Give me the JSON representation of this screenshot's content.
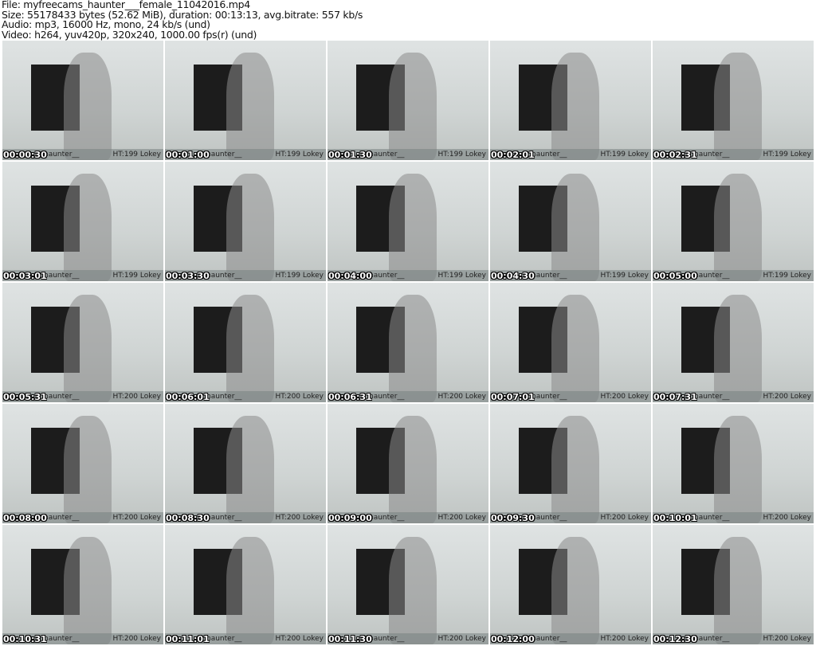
{
  "header": {
    "file": "File: myfreecams_haunter___female_11042016.mp4",
    "size": "Size: 55178433 bytes (52.62 MiB), duration: 00:13:13, avg.bitrate: 557 kb/s",
    "audio": "Audio: mp3, 16000 Hz, mono, 24 kb/s (und)",
    "video": "Video: h264, yuv420p, 320x240, 1000.00 fps(r) (und)"
  },
  "thumbnails": [
    {
      "time": "00:00:30",
      "user": "haunter__",
      "ht": "HT:199 Lokey"
    },
    {
      "time": "00:01:00",
      "user": "haunter__",
      "ht": "HT:199 Lokey"
    },
    {
      "time": "00:01:30",
      "user": "haunter__",
      "ht": "HT:199 Lokey"
    },
    {
      "time": "00:02:01",
      "user": "haunter__",
      "ht": "HT:199 Lokey"
    },
    {
      "time": "00:02:31",
      "user": "haunter__",
      "ht": "HT:199 Lokey"
    },
    {
      "time": "00:03:01",
      "user": "haunter__",
      "ht": "HT:199 Lokey"
    },
    {
      "time": "00:03:30",
      "user": "haunter__",
      "ht": "HT:199 Lokey"
    },
    {
      "time": "00:04:00",
      "user": "haunter__",
      "ht": "HT:199 Lokey"
    },
    {
      "time": "00:04:30",
      "user": "haunter__",
      "ht": "HT:199 Lokey"
    },
    {
      "time": "00:05:00",
      "user": "haunter__",
      "ht": "HT:199 Lokey"
    },
    {
      "time": "00:05:31",
      "user": "haunter__",
      "ht": "HT:200 Lokey"
    },
    {
      "time": "00:06:01",
      "user": "haunter__",
      "ht": "HT:200 Lokey"
    },
    {
      "time": "00:06:31",
      "user": "haunter__",
      "ht": "HT:200 Lokey"
    },
    {
      "time": "00:07:01",
      "user": "haunter__",
      "ht": "HT:200 Lokey"
    },
    {
      "time": "00:07:31",
      "user": "haunter__",
      "ht": "HT:200 Lokey"
    },
    {
      "time": "00:08:00",
      "user": "haunter__",
      "ht": "HT:200 Lokey"
    },
    {
      "time": "00:08:30",
      "user": "haunter__",
      "ht": "HT:200 Lokey"
    },
    {
      "time": "00:09:00",
      "user": "haunter__",
      "ht": "HT:200 Lokey"
    },
    {
      "time": "00:09:30",
      "user": "haunter__",
      "ht": "HT:200 Lokey"
    },
    {
      "time": "00:10:01",
      "user": "haunter__",
      "ht": "HT:200 Lokey"
    },
    {
      "time": "00:10:31",
      "user": "haunter__",
      "ht": "HT:200 Lokey"
    },
    {
      "time": "00:11:01",
      "user": "haunter__",
      "ht": "HT:200 Lokey"
    },
    {
      "time": "00:11:30",
      "user": "haunter__",
      "ht": "HT:200 Lokey"
    },
    {
      "time": "00:12:00",
      "user": "haunter__",
      "ht": "HT:200 Lokey"
    },
    {
      "time": "00:12:30",
      "user": "haunter__",
      "ht": "HT:200 Lokey"
    }
  ]
}
